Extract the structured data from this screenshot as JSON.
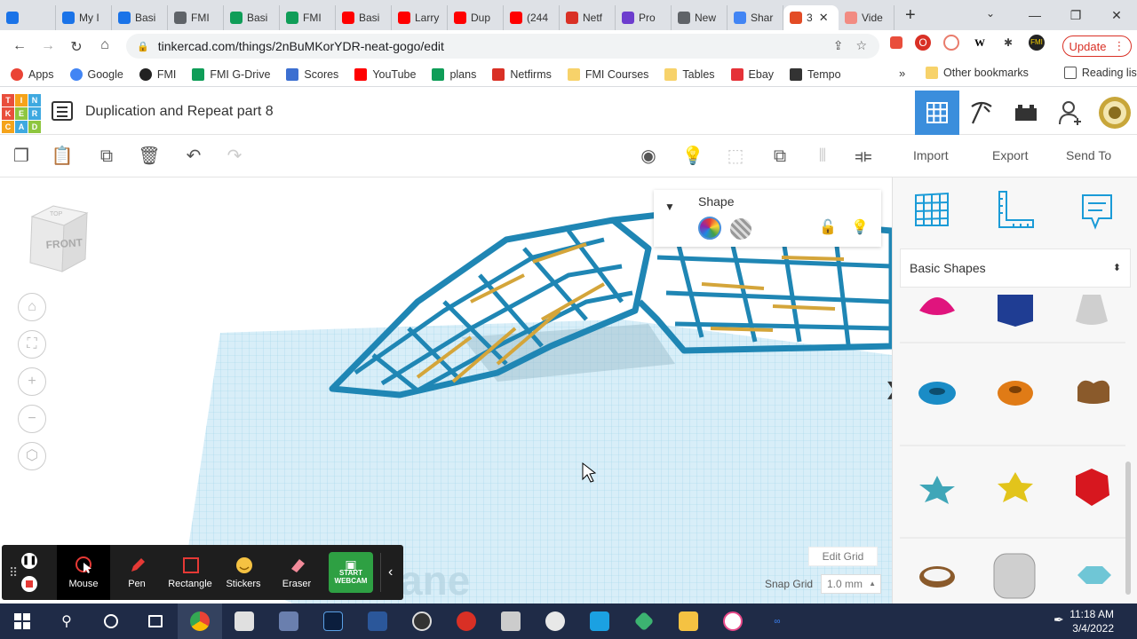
{
  "browser": {
    "tabs": [
      {
        "label": "",
        "color": "#1a73e8"
      },
      {
        "label": "My I",
        "color": "#1a73e8"
      },
      {
        "label": "Basi",
        "color": "#1a73e8"
      },
      {
        "label": "FMI",
        "color": "#5f6368"
      },
      {
        "label": "Basi",
        "color": "#0f9d58"
      },
      {
        "label": "FMI",
        "color": "#0f9d58"
      },
      {
        "label": "Basi",
        "color": "#ff0000"
      },
      {
        "label": "Larry",
        "color": "#ff0000"
      },
      {
        "label": "Dup",
        "color": "#ff0000"
      },
      {
        "label": "(244",
        "color": "#ff0000"
      },
      {
        "label": "Netf",
        "color": "#d93025"
      },
      {
        "label": "Pro",
        "color": "#6d3dce"
      },
      {
        "label": "New",
        "color": "#5f6368"
      },
      {
        "label": "Shar",
        "color": "#4285f4"
      },
      {
        "label": "3",
        "color": "#e34c26",
        "active": true
      },
      {
        "label": "Vide",
        "color": "#f28b82"
      }
    ],
    "url": "tinkercad.com/things/2nBuMKorYDR-neat-gogo/edit",
    "update_label": "Update",
    "bookmarks": [
      {
        "label": "Apps",
        "color": "#ea4335"
      },
      {
        "label": "Google",
        "color": "#4285f4"
      },
      {
        "label": "FMI",
        "color": "#222"
      },
      {
        "label": "FMI G-Drive",
        "color": "#0f9d58"
      },
      {
        "label": "Scores",
        "color": "#3c6fd1"
      },
      {
        "label": "YouTube",
        "color": "#ff0000"
      },
      {
        "label": "plans",
        "color": "#0f9d58"
      },
      {
        "label": "Netfirms",
        "color": "#d93025"
      },
      {
        "label": "FMI Courses",
        "color": "#f7d26a"
      },
      {
        "label": "Tables",
        "color": "#f7d26a"
      },
      {
        "label": "Ebay",
        "color": "#e53238"
      },
      {
        "label": "Tempo",
        "color": "#333"
      }
    ],
    "bookmarks_more": "»",
    "other_bookmarks": "Other bookmarks",
    "reading_list": "Reading list"
  },
  "app": {
    "title": "Duplication and Repeat part 8",
    "logo_letters": [
      "T",
      "I",
      "N",
      "K",
      "E",
      "R",
      "C",
      "A",
      "D"
    ],
    "logo_colors": [
      "#e94e3c",
      "#f5a31a",
      "#3fa9e0",
      "#e94e3c",
      "#8ec63f",
      "#3fa9e0",
      "#f5a31a",
      "#3fa9e0",
      "#8ec63f"
    ]
  },
  "toolbar": {
    "import_label": "Import",
    "export_label": "Export",
    "send_to_label": "Send To"
  },
  "shape_panel": {
    "title": "Shape"
  },
  "viewcube": {
    "front_label": "FRONT",
    "top_label": "TOP"
  },
  "workplane": {
    "edit_grid_label": "Edit Grid",
    "snap_grid_label": "Snap Grid",
    "snap_grid_value": "1.0 mm",
    "watermark": "ane"
  },
  "sidebar": {
    "category": "Basic Shapes",
    "collapse_glyph": "❯"
  },
  "recorder": {
    "items": [
      {
        "label": "Mouse",
        "selected": true
      },
      {
        "label": "Pen"
      },
      {
        "label": "Rectangle"
      },
      {
        "label": "Stickers"
      },
      {
        "label": "Eraser"
      }
    ],
    "webcam_line1": "START",
    "webcam_line2": "WEBCAM"
  },
  "taskbar": {
    "time": "11:18 AM",
    "date": "3/4/2022"
  }
}
